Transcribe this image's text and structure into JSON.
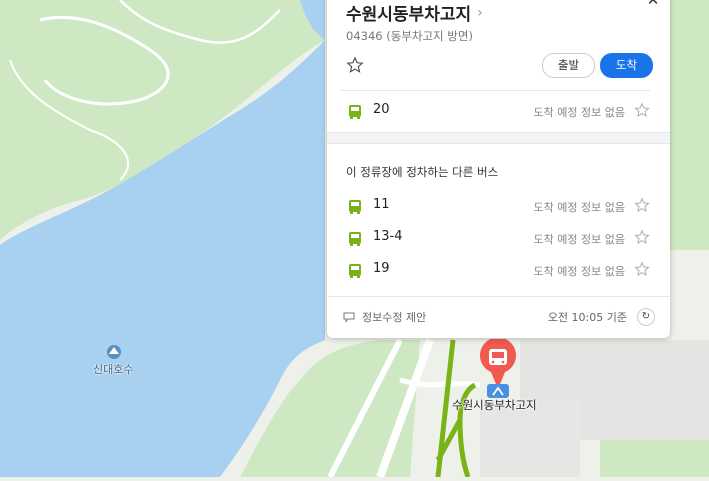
{
  "stop": {
    "name": "수원시동부차고지",
    "subtitle": "04346 (동부차고지 방면)",
    "departure_label": "출발",
    "arrival_label": "도착"
  },
  "main_route": {
    "number": "20",
    "status": "도착 예정 정보 없음"
  },
  "other_buses_title": "이 정류장에 정차하는 다른 버스",
  "other_buses": [
    {
      "number": "11",
      "status": "도착 예정 정보 없음"
    },
    {
      "number": "13-4",
      "status": "도착 예정 정보 없음"
    },
    {
      "number": "19",
      "status": "도착 예정 정보 없음"
    }
  ],
  "footer": {
    "suggest_label": "정보수정 제안",
    "updated": "오전 10:05 기준"
  },
  "map": {
    "lake_label": "신대호수",
    "stop_label": "수원시동부차고지"
  },
  "colors": {
    "accent": "#1a73e8",
    "bus_green": "#7ab317",
    "water": "#a8d0f0",
    "park": "#cfe8c4",
    "pin": "#f05a50"
  },
  "icons": [
    "close-icon",
    "chevron-right-icon",
    "star-icon",
    "bus-icon",
    "suggest-icon",
    "refresh-icon",
    "lake-icon",
    "bus-stop-pin-icon"
  ]
}
